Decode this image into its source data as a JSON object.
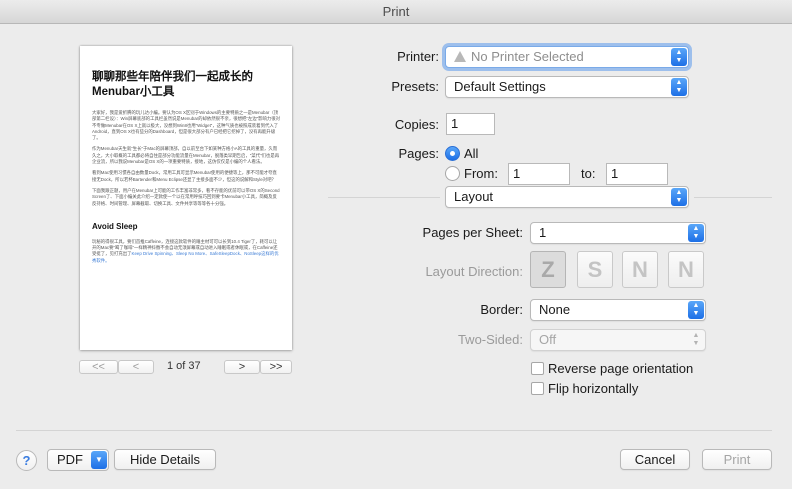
{
  "window": {
    "title": "Print"
  },
  "preview": {
    "title": "聊聊那些年陪伴我们一起成长的Menubar小工具",
    "paragraphs": [
      "大家好，我是爱折腾的玩儿达小编。要认为OS X区别于Windows的主要特质之一是Menubar（顶部第二栏设）：Win屏幕底部的工具栏虽然说是Menubar的却依然很不亲，很想把“左边”影响力很对不专做Menubar在OS X上就以极大，没想到Win8也用“Widget”，这种气质也被照成装着到代入了Android，直到OS X也有些分的Dashboard，但是很大部分有户已经把它挖掉了，没有再能升级了。",
      "作为Menubar天生就“生长”于Mac的屏幕顶部，自以前至台下如某种方格小A的工具的重量，久而久之，大小取概的工具都必将自住是部分功能流量在Menubar，脱落类早期告启，“菜代”们也是再企业流，所以我说Menubar是OS X的一项重要特质，接地，这仿仅仅是小编的个人看法。",
      "看到Mac使用习惯各自由数量Dock，常用工具可显示Menubar使用的便捷等上，那不可能才夸直接无Dock，所以若杯Bartender和Menu Eclipse还显了主接多面不少，但这的说解和Style对吧？",
      "下面我跟正题，用户在Menubar上可能的工作丰富非常多，看不存能的优前可以带OS X的Second Screen了、下面小编关此介绍一定款使一个以在常用呼技巧回到要卡Menubar小工具，简概及反反持格、时间管理、屏幕截取、切换工具、文件共享等等等各十分强。"
    ],
    "section_title": "Avoid Sleep",
    "section_text": "玩秘的得很工具，要们首推Caffeine，连接这款软件的睡主材可可以长到10.4 Tiger了，耗可以让开的Mac要“喝了咖啡”一样精神抖擞不会自动无须屏幕或自动进入睡眠或者休眠或，在Caffeine还受挺了，见打充出了",
    "section_links": "Keep Drive Spinning、Sleep No More、SafeSleepDock、NoSleep这样的优秀软件。"
  },
  "pager": {
    "first": "<<",
    "prev": "<",
    "page_text": "1 of 37",
    "next": ">",
    "last": ">>"
  },
  "printer": {
    "label": "Printer:",
    "value": "No Printer Selected"
  },
  "presets": {
    "label": "Presets:",
    "value": "Default Settings"
  },
  "copies": {
    "label": "Copies:",
    "value": "1"
  },
  "pages": {
    "label": "Pages:",
    "all_label": "All",
    "from_label": "From:",
    "from_value": "1",
    "to_label": "to:",
    "to_value": "1"
  },
  "section_popup": {
    "value": "Layout"
  },
  "layout": {
    "pages_per_sheet_label": "Pages per Sheet:",
    "pages_per_sheet_value": "1",
    "direction_label": "Layout Direction:",
    "directions": [
      "Z",
      "S",
      "N",
      "N"
    ],
    "border_label": "Border:",
    "border_value": "None",
    "two_sided_label": "Two-Sided:",
    "two_sided_value": "Off",
    "reverse_label": "Reverse page orientation",
    "flip_label": "Flip horizontally"
  },
  "footer": {
    "help": "?",
    "pdf": "PDF",
    "hide_details": "Hide Details",
    "cancel": "Cancel",
    "print": "Print"
  }
}
